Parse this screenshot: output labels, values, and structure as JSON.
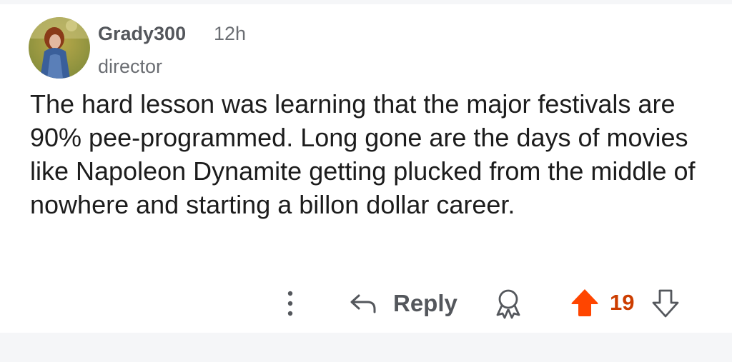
{
  "comment": {
    "username": "Grady300",
    "timestamp": "12h",
    "flair": "director",
    "body": "The hard lesson was learning that the major festivals are 90% pee-programmed. Long gone are the days of movies like Napoleon Dynamite getting plucked from the middle of nowhere and starting a billon dollar career."
  },
  "actions": {
    "reply_label": "Reply",
    "vote_count": "19"
  },
  "icons": {
    "more": "more-vertical-icon",
    "reply": "reply-arrow-icon",
    "award": "award-icon",
    "upvote": "upvote-arrow-icon",
    "downvote": "downvote-arrow-icon"
  },
  "colors": {
    "upvote_active": "#ff4500",
    "vote_count": "#cc3d00",
    "username": "#54575c",
    "meta": "#6b6e73",
    "body_text": "#1c1c1c"
  }
}
